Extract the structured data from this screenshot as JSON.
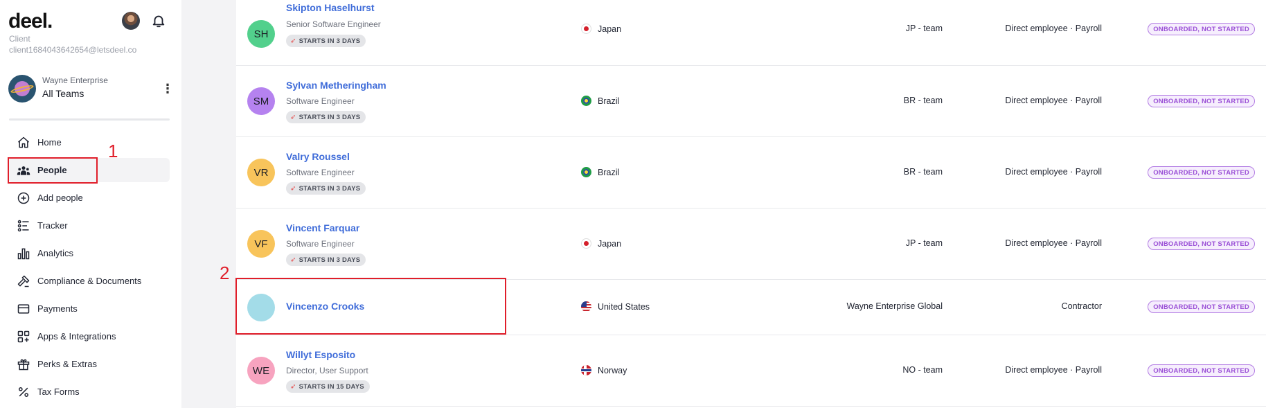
{
  "app": {
    "logo": "deel.",
    "user_role": "Client",
    "user_email": "client1684043642654@letsdeel.co"
  },
  "org": {
    "name": "Wayne Enterprise",
    "team": "All Teams"
  },
  "nav": [
    {
      "label": "Home",
      "icon": "home-icon"
    },
    {
      "label": "People",
      "icon": "people-icon",
      "active": true
    },
    {
      "label": "Add people",
      "icon": "add-circle-icon"
    },
    {
      "label": "Tracker",
      "icon": "tracker-icon"
    },
    {
      "label": "Analytics",
      "icon": "bar-chart-icon"
    },
    {
      "label": "Compliance & Documents",
      "icon": "gavel-icon"
    },
    {
      "label": "Payments",
      "icon": "credit-card-icon"
    },
    {
      "label": "Apps & Integrations",
      "icon": "integrations-icon"
    },
    {
      "label": "Perks & Extras",
      "icon": "gift-icon"
    },
    {
      "label": "Tax Forms",
      "icon": "percent-icon"
    }
  ],
  "annotations": [
    "1",
    "2"
  ],
  "people": [
    {
      "initials": "SH",
      "avatar_color": "#52d08c",
      "name": "Skipton Haselhurst",
      "title": "Senior Software Engineer",
      "badge": "STARTS IN 3 DAYS",
      "country": "Japan",
      "flag": "jp",
      "team": "JP - team",
      "type": "Direct employee · Payroll",
      "status": "ONBOARDED, NOT STARTED"
    },
    {
      "initials": "SM",
      "avatar_color": "#b582ef",
      "name": "Sylvan Metheringham",
      "title": "Software Engineer",
      "badge": "STARTS IN 3 DAYS",
      "country": "Brazil",
      "flag": "br",
      "team": "BR - team",
      "type": "Direct employee · Payroll",
      "status": "ONBOARDED, NOT STARTED"
    },
    {
      "initials": "VR",
      "avatar_color": "#f8c45b",
      "name": "Valry Roussel",
      "title": "Software Engineer",
      "badge": "STARTS IN 3 DAYS",
      "country": "Brazil",
      "flag": "br",
      "team": "BR - team",
      "type": "Direct employee · Payroll",
      "status": "ONBOARDED, NOT STARTED"
    },
    {
      "initials": "VF",
      "avatar_color": "#f8c45b",
      "name": "Vincent Farquar",
      "title": "Software Engineer",
      "badge": "STARTS IN 3 DAYS",
      "country": "Japan",
      "flag": "jp",
      "team": "JP - team",
      "type": "Direct employee · Payroll",
      "status": "ONBOARDED, NOT STARTED"
    },
    {
      "initials": "",
      "avatar_color": "#a3dce8",
      "name": "Vincenzo Crooks",
      "title": "",
      "badge": "",
      "country": "United States",
      "flag": "us",
      "team": "Wayne Enterprise Global",
      "type": "Contractor",
      "status": "ONBOARDED, NOT STARTED"
    },
    {
      "initials": "WE",
      "avatar_color": "#f7a3bf",
      "name": "Willyt Esposito",
      "title": "Director, User Support",
      "badge": "STARTS IN 15 DAYS",
      "country": "Norway",
      "flag": "no",
      "team": "NO - team",
      "type": "Direct employee · Payroll",
      "status": "ONBOARDED, NOT STARTED"
    }
  ]
}
